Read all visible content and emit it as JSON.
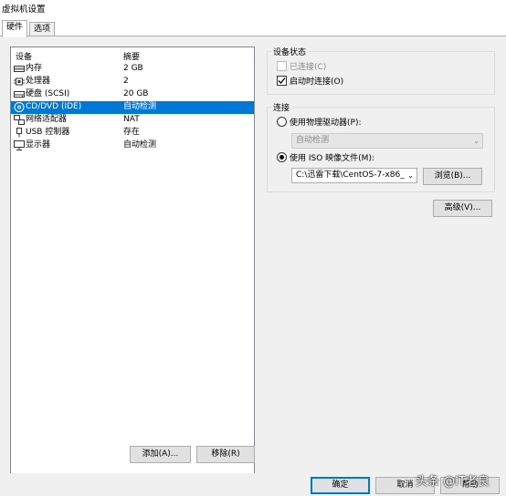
{
  "window": {
    "title": "虚拟机设置"
  },
  "tabs": [
    {
      "label": "硬件"
    },
    {
      "label": "选项"
    }
  ],
  "device_list": {
    "header_device": "设备",
    "header_summary": "摘要",
    "rows": [
      {
        "name": "内存",
        "summary": "2 GB",
        "icon": "memory-icon"
      },
      {
        "name": "处理器",
        "summary": "2",
        "icon": "cpu-icon"
      },
      {
        "name": "硬盘 (SCSI)",
        "summary": "20 GB",
        "icon": "harddisk-icon"
      },
      {
        "name": "CD/DVD (IDE)",
        "summary": "自动检测",
        "icon": "cd-icon"
      },
      {
        "name": "网络适配器",
        "summary": "NAT",
        "icon": "network-icon"
      },
      {
        "name": "USB 控制器",
        "summary": "存在",
        "icon": "usb-icon"
      },
      {
        "name": "显示器",
        "summary": "自动检测",
        "icon": "monitor-icon"
      }
    ],
    "selected_index": 3
  },
  "list_buttons": {
    "add": "添加(A)...",
    "remove": "移除(R)"
  },
  "device_status": {
    "title": "设备状态",
    "connected_label": "已连接(C)",
    "connect_at_power_on_label": "启动时连接(O)",
    "connected": false,
    "connect_at_power_on": true
  },
  "connection": {
    "title": "连接",
    "physical_label": "使用物理驱动器(P):",
    "physical_value": "自动检测",
    "iso_label": "使用 ISO 映像文件(M):",
    "iso_value": "C:\\迅雷下载\\CentOS-7-x86_",
    "browse_label": "浏览(B)...",
    "selected": "iso"
  },
  "advanced_label": "高级(V)...",
  "dialog_buttons": {
    "ok": "确定",
    "cancel": "取消",
    "help": "帮助"
  },
  "watermark": "头条 @IT老良",
  "colors": {
    "selection": "#0078d7",
    "panel": "#f0f0f0"
  }
}
